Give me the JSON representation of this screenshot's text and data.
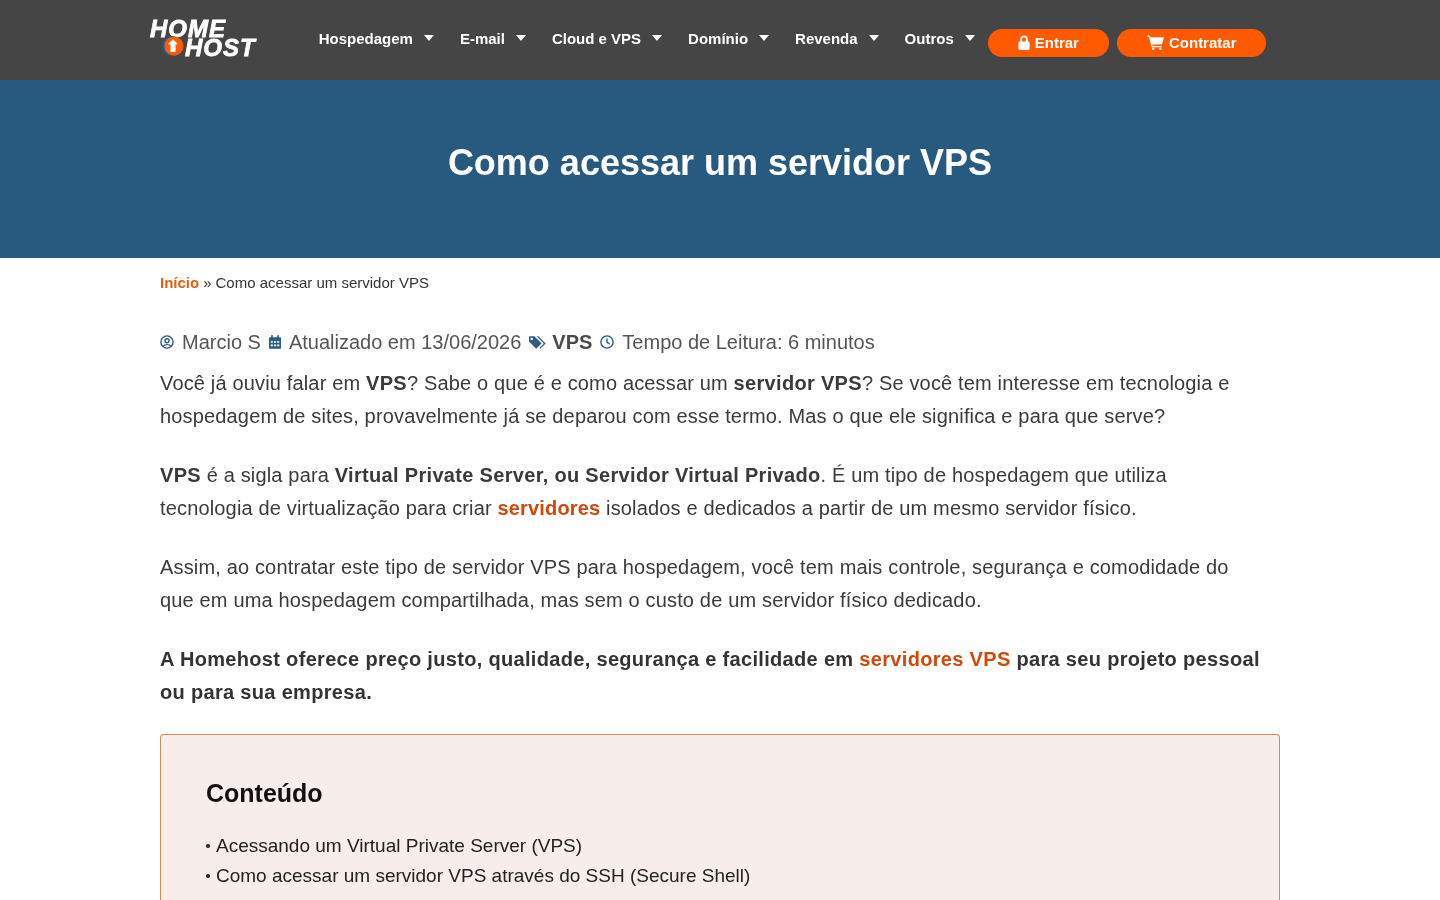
{
  "header": {
    "logo": {
      "line_1": "HOME",
      "line_2": "HOST"
    },
    "nav": [
      {
        "label": "Hospedagem",
        "dropdown": true
      },
      {
        "label": "E-mail",
        "dropdown": true
      },
      {
        "label": "Cloud e VPS",
        "dropdown": true
      },
      {
        "label": "Domínio",
        "dropdown": true
      },
      {
        "label": "Revenda",
        "dropdown": true
      },
      {
        "label": "Outros",
        "dropdown": true
      }
    ],
    "buttons": [
      {
        "label": "Entrar",
        "kind": "login"
      },
      {
        "label": "Contratar",
        "kind": "purchase"
      }
    ]
  },
  "hero": {
    "title": "Como acessar um servidor VPS"
  },
  "breadcrumb": [
    {
      "label": "Início",
      "kind": "link"
    },
    {
      "label": "»",
      "kind": "separator"
    },
    {
      "label": "Como acessar um servidor VPS",
      "kind": "current"
    }
  ],
  "meta": [
    {
      "kind": "author",
      "text": "Marcio S"
    },
    {
      "kind": "date",
      "text": "Atualizado em 13/06/2026"
    },
    {
      "kind": "category",
      "text": "VPS"
    },
    {
      "kind": "reading_time",
      "text": "Tempo de Leitura: 6 minutos"
    }
  ],
  "article": {
    "paragraphs": [
      {
        "bold": false,
        "parts": [
          {
            "kind": "text",
            "text": "Você já ouviu falar em **VPS**? Sabe o que é e como acessar um **servidor VPS**? Se você tem interesse em tecnologia e hospedagem de sites, provavelmente já se deparou com esse termo. Mas o que ele significa e para que serve?"
          }
        ]
      },
      {
        "bold": false,
        "parts": [
          {
            "kind": "text",
            "text": "**VPS** é a sigla para **Virtual Private Server, ou Servidor Virtual Privado**. É um tipo de hospedagem que utiliza tecnologia de virtualização para criar "
          },
          {
            "kind": "link",
            "text": "servidores"
          },
          {
            "kind": "text",
            "text": " isolados e dedicados a partir de um mesmo servidor físico."
          }
        ]
      },
      {
        "bold": false,
        "parts": [
          {
            "kind": "text",
            "text": "Assim, ao contratar este tipo de servidor VPS para hospedagem, você tem mais controle, segurança e comodidade do que em uma hospedagem compartilhada, mas sem o custo de um servidor físico dedicado."
          }
        ]
      },
      {
        "bold": true,
        "parts": [
          {
            "kind": "text",
            "text": "A Homehost oferece preço justo, qualidade, segurança e facilidade em "
          },
          {
            "kind": "link",
            "text": "servidores VPS"
          },
          {
            "kind": "text",
            "text": " para seu projeto pessoal ou para sua empresa."
          }
        ]
      }
    ]
  },
  "toc": {
    "title": "Conteúdo",
    "items": [
      "Acessando um Virtual Private Server (VPS)",
      "Como acessar um servidor VPS através do SSH (Secure Shell)"
    ]
  }
}
